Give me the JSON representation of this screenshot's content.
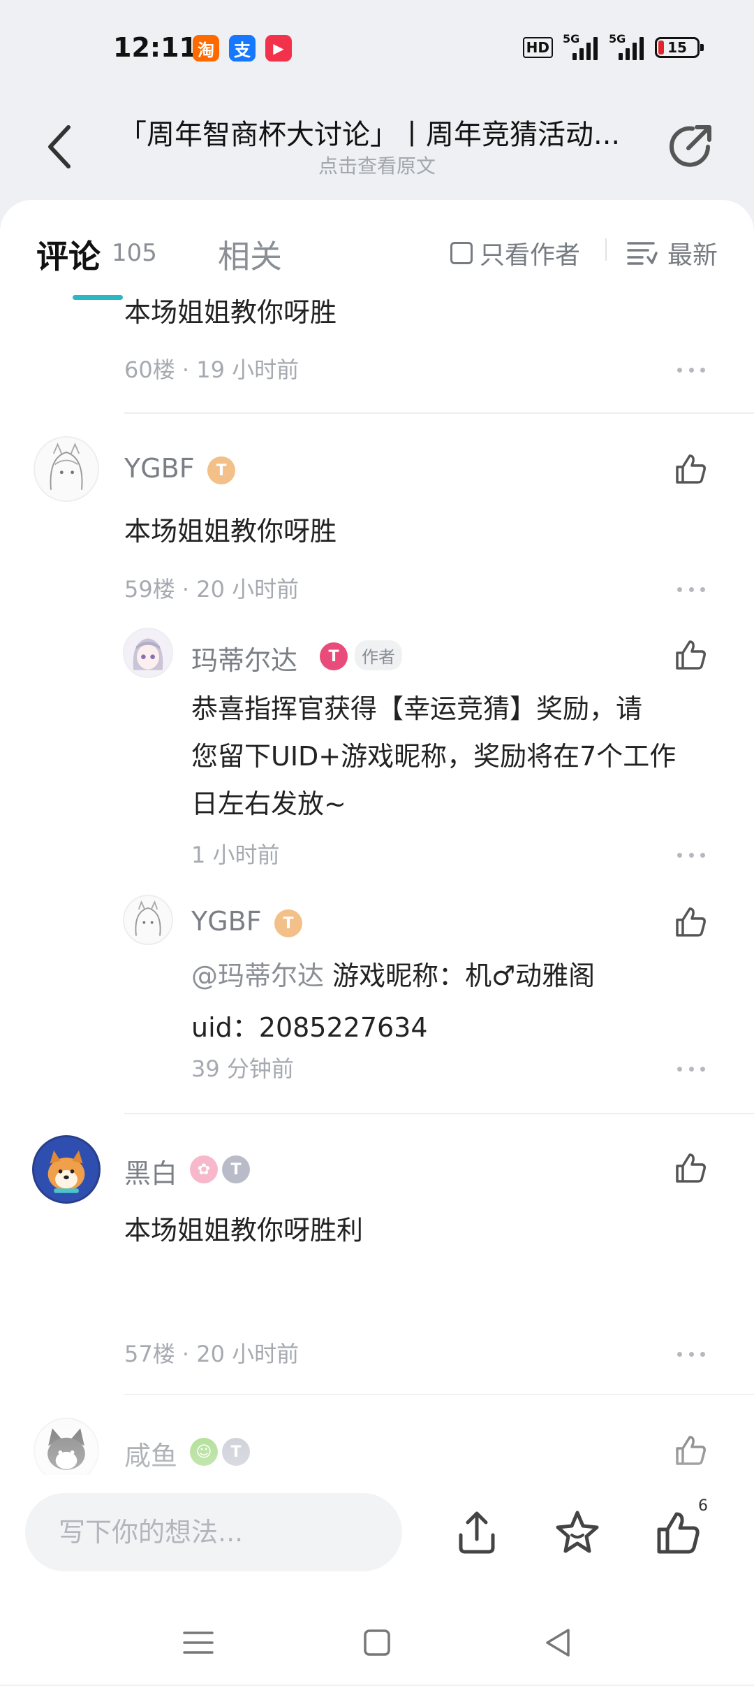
{
  "status_bar": {
    "time": "12:11",
    "app_icons": [
      {
        "name": "taobao-icon",
        "glyph": "淘",
        "color": "#ff6a00"
      },
      {
        "name": "alipay-icon",
        "glyph": "支",
        "color": "#1677ff"
      },
      {
        "name": "video-app-icon",
        "glyph": "▶",
        "color": "#f2314a"
      }
    ],
    "hd_label": "HD",
    "network_1": "5G",
    "network_2": "5G",
    "battery": "15"
  },
  "header": {
    "title": "「周年智商杯大讨论」丨周年竞猜活动...",
    "subtitle": "点击查看原文"
  },
  "tabs": {
    "comments_label": "评论",
    "comments_count": "105",
    "related_label": "相关",
    "author_only_label": "只看作者",
    "sort_label": "最新"
  },
  "comments": {
    "c60": {
      "text": "本场姐姐教你呀胜",
      "meta": "60楼 · 19 小时前"
    },
    "c59": {
      "username": "YGBF",
      "text": "本场姐姐教你呀胜",
      "meta": "59楼 · 20 小时前",
      "replies": [
        {
          "username": "玛蒂尔达",
          "author_tag": "作者",
          "lines": [
            "恭喜指挥官获得【幸运竞猜】奖励，请",
            "您留下UID+游戏昵称，奖励将在7个工作",
            "日左右发放~"
          ],
          "meta": "1 小时前"
        },
        {
          "username": "YGBF",
          "mention": "@玛蒂尔达",
          "line1": " 游戏昵称：机♂动雅阁",
          "line2": "uid：2085227634",
          "meta": "39 分钟前"
        }
      ]
    },
    "c57": {
      "username": "黑白",
      "text": "本场姐姐教你呀胜利",
      "meta": "57楼 · 20 小时前"
    },
    "c56": {
      "username": "咸鱼"
    }
  },
  "bottom_bar": {
    "input_placeholder": "写下你的想法...",
    "like_count": "6"
  },
  "colors": {
    "accent": "#2bb7c4",
    "meta_gray": "#a6aab0",
    "background": "#eef0f3"
  }
}
